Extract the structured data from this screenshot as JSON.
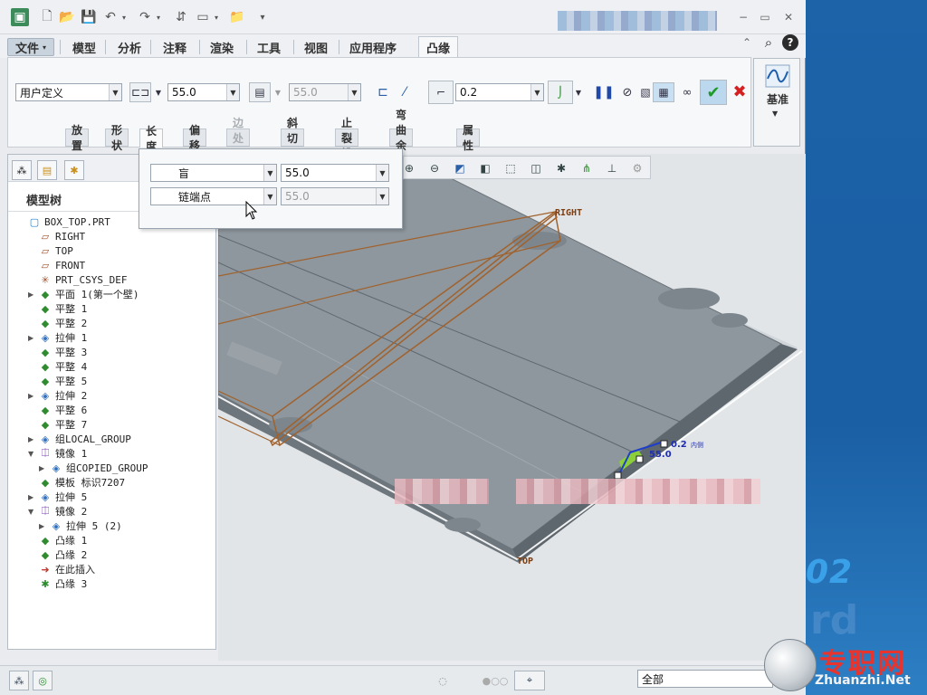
{
  "titlebar": {
    "quick_access": [
      "save-icon",
      "new-icon",
      "open-icon",
      "undo-icon",
      "redo-icon",
      "regenerate-icon",
      "window-icon",
      "folder-icon"
    ],
    "window_controls": [
      "minimize",
      "maximize",
      "close"
    ]
  },
  "menu": {
    "file": "文件",
    "items": [
      "模型",
      "分析",
      "注释",
      "渲染",
      "工具",
      "视图",
      "应用程序"
    ],
    "active": "凸缘"
  },
  "ribbon": {
    "shape_select": "用户定义",
    "length_value": "55.0",
    "offset_value": "55.0",
    "radius_value": "0.2",
    "datum_label": "基准"
  },
  "subtabs": [
    {
      "label": "放置",
      "state": "normal"
    },
    {
      "label": "形状",
      "state": "normal"
    },
    {
      "label": "长度",
      "state": "active"
    },
    {
      "label": "偏移",
      "state": "normal"
    },
    {
      "label": "边处理",
      "state": "disabled"
    },
    {
      "label": "斜切口",
      "state": "normal"
    },
    {
      "label": "止裂槽",
      "state": "normal"
    },
    {
      "label": "弯曲余量",
      "state": "normal"
    },
    {
      "label": "属性",
      "state": "normal"
    }
  ],
  "popup": {
    "row1_type": "盲",
    "row1_value": "55.0",
    "row2_type": "链端点",
    "row2_value": "55.0"
  },
  "tree": {
    "title": "模型树",
    "items": [
      {
        "label": "BOX_TOP.PRT",
        "icon": "part",
        "indent": 0,
        "expand": ""
      },
      {
        "label": "RIGHT",
        "icon": "plane",
        "indent": 1,
        "expand": ""
      },
      {
        "label": "TOP",
        "icon": "plane",
        "indent": 1,
        "expand": ""
      },
      {
        "label": "FRONT",
        "icon": "plane",
        "indent": 1,
        "expand": ""
      },
      {
        "label": "PRT_CSYS_DEF",
        "icon": "csys",
        "indent": 1,
        "expand": ""
      },
      {
        "label": "平面 1(第一个壁)",
        "icon": "green",
        "indent": 1,
        "expand": "▶"
      },
      {
        "label": "平整 1",
        "icon": "green",
        "indent": 1,
        "expand": ""
      },
      {
        "label": "平整 2",
        "icon": "green",
        "indent": 1,
        "expand": ""
      },
      {
        "label": "拉伸 1",
        "icon": "blue",
        "indent": 1,
        "expand": "▶"
      },
      {
        "label": "平整 3",
        "icon": "green",
        "indent": 1,
        "expand": ""
      },
      {
        "label": "平整 4",
        "icon": "green",
        "indent": 1,
        "expand": ""
      },
      {
        "label": "平整 5",
        "icon": "green",
        "indent": 1,
        "expand": ""
      },
      {
        "label": "拉伸 2",
        "icon": "blue",
        "indent": 1,
        "expand": "▶"
      },
      {
        "label": "平整 6",
        "icon": "green",
        "indent": 1,
        "expand": ""
      },
      {
        "label": "平整 7",
        "icon": "green",
        "indent": 1,
        "expand": ""
      },
      {
        "label": "组LOCAL_GROUP",
        "icon": "blue",
        "indent": 1,
        "expand": "▶"
      },
      {
        "label": "镜像 1",
        "icon": "purple",
        "indent": 1,
        "expand": "▼"
      },
      {
        "label": "组COPIED_GROUP",
        "icon": "blue",
        "indent": 2,
        "expand": "▶"
      },
      {
        "label": "模板 标识7207",
        "icon": "green",
        "indent": 1,
        "expand": ""
      },
      {
        "label": "拉伸 5",
        "icon": "blue",
        "indent": 1,
        "expand": "▶"
      },
      {
        "label": "镜像 2",
        "icon": "purple",
        "indent": 1,
        "expand": "▼"
      },
      {
        "label": "拉伸 5 (2)",
        "icon": "blue",
        "indent": 2,
        "expand": "▶"
      },
      {
        "label": "凸缘 1",
        "icon": "green",
        "indent": 1,
        "expand": ""
      },
      {
        "label": "凸缘 2",
        "icon": "green",
        "indent": 1,
        "expand": ""
      },
      {
        "label": "在此插入",
        "icon": "red",
        "indent": 1,
        "expand": ""
      },
      {
        "label": "凸缘 3",
        "icon": "green-star",
        "indent": 1,
        "expand": ""
      }
    ]
  },
  "graphics": {
    "label_right": "RIGHT",
    "label_top": "TOP",
    "dim_radius": "0.2",
    "dim_radius_suffix": "内侧",
    "dim_length": "55.0"
  },
  "status": {
    "filter": "全部"
  },
  "watermark": {
    "site": "专职网",
    "url": "Zhuanzhi.Net",
    "digits": "02",
    "ghost": "rd"
  },
  "colors": {
    "model_gray": "#8e979e",
    "model_edge": "#6b747b",
    "datum_brown": "#a0622d",
    "accent_blue": "#1f6fb4"
  }
}
